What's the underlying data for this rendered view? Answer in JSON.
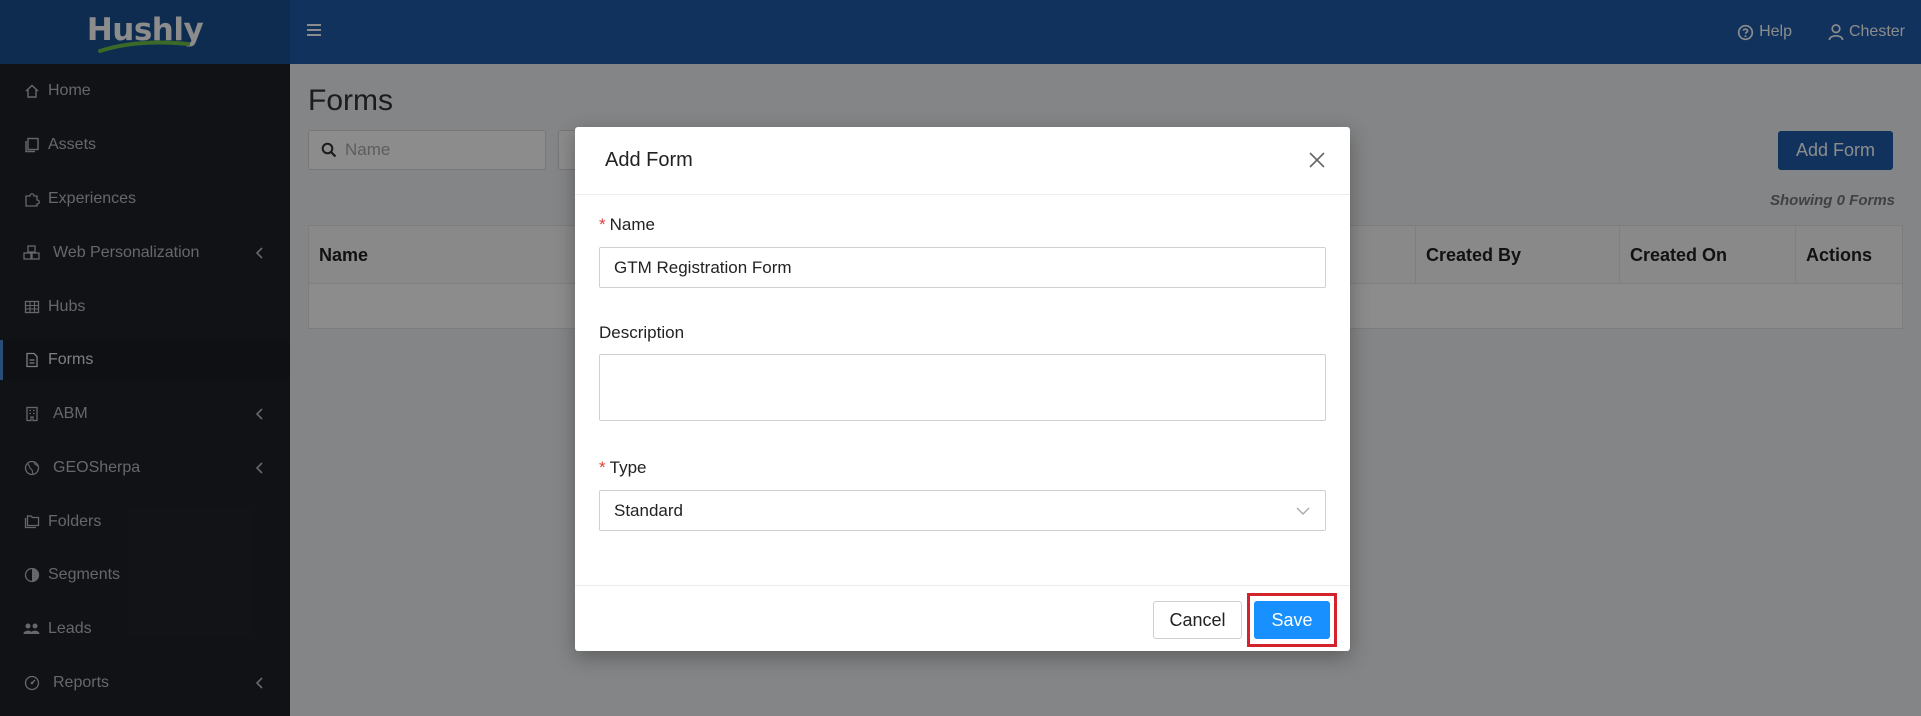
{
  "app": {
    "logo": "Hushly"
  },
  "topbar": {
    "help_label": "Help",
    "user_label": "Chester"
  },
  "sidebar": {
    "items": [
      {
        "label": "Home",
        "icon": "home-icon"
      },
      {
        "label": "Assets",
        "icon": "copy-icon"
      },
      {
        "label": "Experiences",
        "icon": "puzzle-icon"
      },
      {
        "label": "Web Personalization",
        "icon": "blocks-icon",
        "has_submenu": true
      },
      {
        "label": "Hubs",
        "icon": "table-icon"
      },
      {
        "label": "Forms",
        "icon": "file-icon",
        "active": true
      },
      {
        "label": "ABM",
        "icon": "building-icon",
        "has_submenu": true
      },
      {
        "label": "GEOSherpa",
        "icon": "globe-icon",
        "has_submenu": true
      },
      {
        "label": "Folders",
        "icon": "folders-icon"
      },
      {
        "label": "Segments",
        "icon": "pie-icon"
      },
      {
        "label": "Leads",
        "icon": "team-icon"
      },
      {
        "label": "Reports",
        "icon": "dashboard-icon",
        "has_submenu": true
      }
    ]
  },
  "page": {
    "title": "Forms",
    "search_placeholder": "Name",
    "add_button": "Add Form",
    "showing_text": "Showing 0 Forms",
    "columns": [
      "Name",
      "Created By",
      "Created On",
      "Actions"
    ]
  },
  "modal": {
    "title": "Add Form",
    "name_label": "Name",
    "name_value": "GTM Registration Form",
    "description_label": "Description",
    "description_value": "",
    "type_label": "Type",
    "type_value": "Standard",
    "required_mark": "*",
    "cancel_label": "Cancel",
    "save_label": "Save"
  },
  "colors": {
    "topbar": "#1e5ca8",
    "sidebar": "#1f2228",
    "primary_button": "#1890ff",
    "highlight_border": "#d3232d",
    "required": "#e0413a"
  }
}
